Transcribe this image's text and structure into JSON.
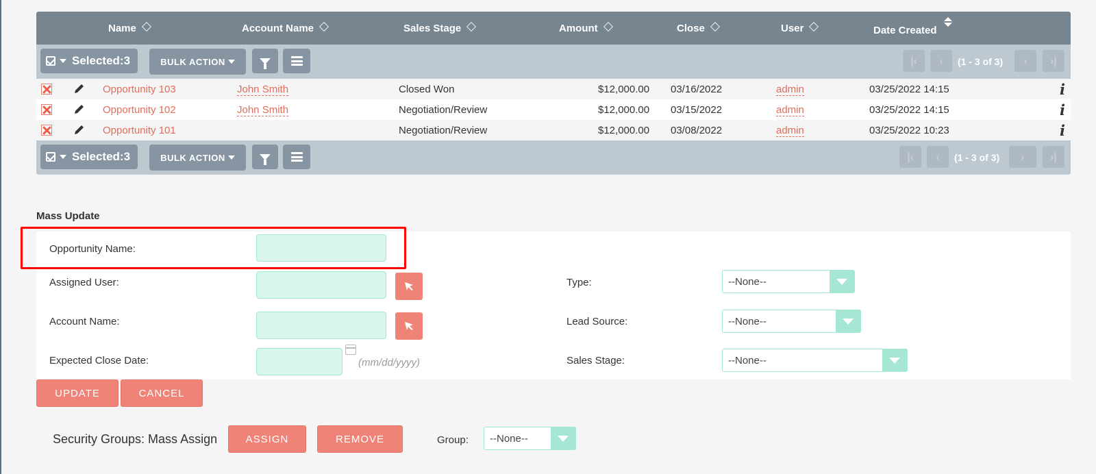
{
  "list": {
    "columns": [
      {
        "label": "Name",
        "sort": "both"
      },
      {
        "label": "Account Name",
        "sort": "both"
      },
      {
        "label": "Sales Stage",
        "sort": "both"
      },
      {
        "label": "Amount",
        "sort": "both"
      },
      {
        "label": "Close",
        "sort": "both"
      },
      {
        "label": "User",
        "sort": "both"
      },
      {
        "label": "Date Created",
        "sort": "desc"
      }
    ],
    "toolbar": {
      "selected_label": "Selected:3",
      "bulk_action_label": "BULK ACTION",
      "pagination_text": "(1 - 3 of 3)"
    },
    "rows": [
      {
        "name": "Opportunity 103",
        "account": "John Smith",
        "stage": "Closed Won",
        "amount": "$12,000.00",
        "close": "03/16/2022",
        "user": "admin",
        "created": "03/25/2022 14:15"
      },
      {
        "name": "Opportunity 102",
        "account": "John Smith",
        "stage": "Negotiation/Review",
        "amount": "$12,000.00",
        "close": "03/15/2022",
        "user": "admin",
        "created": "03/25/2022 14:15"
      },
      {
        "name": "Opportunity 101",
        "account": "",
        "stage": "Negotiation/Review",
        "amount": "$12,000.00",
        "close": "03/08/2022",
        "user": "admin",
        "created": "03/25/2022 10:23"
      }
    ],
    "info_glyph": "i"
  },
  "mass_update": {
    "title": "Mass Update",
    "fields": {
      "opportunity_name": {
        "label": "Opportunity Name:",
        "value": ""
      },
      "assigned_user": {
        "label": "Assigned User:",
        "value": ""
      },
      "account_name": {
        "label": "Account Name:",
        "value": ""
      },
      "expected_close_date": {
        "label": "Expected Close Date:",
        "value": "",
        "format_hint": "(mm/dd/yyyy)"
      },
      "type": {
        "label": "Type:",
        "value": "--None--"
      },
      "lead_source": {
        "label": "Lead Source:",
        "value": "--None--"
      },
      "sales_stage": {
        "label": "Sales Stage:",
        "value": "--None--"
      }
    },
    "update_label": "UPDATE",
    "cancel_label": "CANCEL"
  },
  "security_groups": {
    "title": "Security Groups: Mass Assign",
    "assign_label": "ASSIGN",
    "remove_label": "REMOVE",
    "group_label": "Group:",
    "group_value": "--None--"
  },
  "colors": {
    "header_bg": "#778591",
    "toolbar_bg": "#bec8d1",
    "accent": "#f08377",
    "link": "#e26d5a",
    "input_bg": "#d8f5ee",
    "highlight": "#ff0000"
  }
}
